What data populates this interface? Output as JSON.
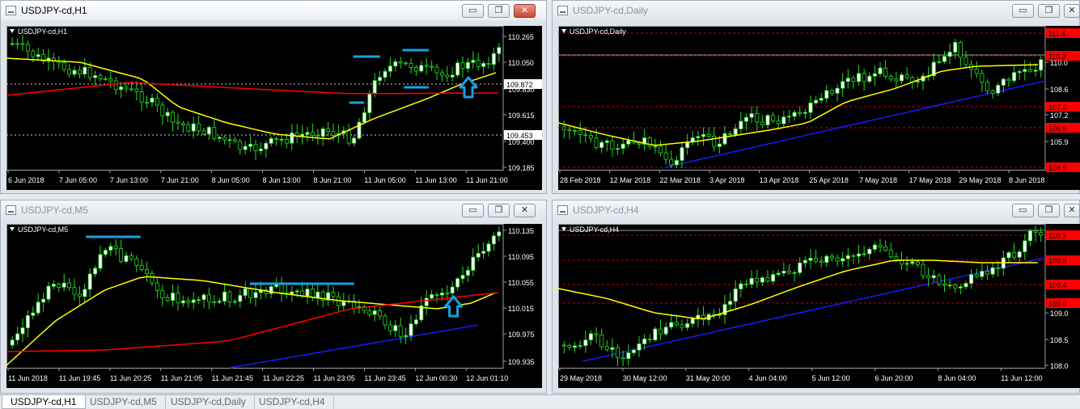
{
  "windows": [
    {
      "key": "h1",
      "title": "USDJPY-cd,H1",
      "symbol_label": "USDJPY-cd,H1",
      "state": "active",
      "price_labels": [
        "110.265",
        "110.050",
        "109.830",
        "109.615",
        "109.400",
        "109.185"
      ],
      "marker_labels": [
        {
          "text": "109.872",
          "bg": "#ffffff",
          "color": "#000000"
        },
        {
          "text": "109.453",
          "bg": "#ffffff",
          "color": "#000000"
        }
      ],
      "time_labels": [
        "6 Jun 2018",
        "7 Jun 05:00",
        "7 Jun 13:00",
        "7 Jun 21:00",
        "8 Jun 05:00",
        "8 Jun 13:00",
        "8 Jun 21:00",
        "11 Jun 05:00",
        "11 Jun 13:00",
        "11 Jun 21:00"
      ]
    },
    {
      "key": "daily",
      "title": "USDJPY-cd,Daily",
      "symbol_label": "USDJPY-cd,Daily",
      "state": "inactive",
      "price_labels": [
        "110.0",
        "108.6",
        "107.2",
        "105.9"
      ],
      "marker_labels": [
        {
          "text": "111.4",
          "bg": "#ff0000",
          "color": "#000000"
        },
        {
          "text": "110.3",
          "bg": "#ff0000",
          "color": "#000000"
        },
        {
          "text": "107.6",
          "bg": "#ff0000",
          "color": "#000000"
        },
        {
          "text": "106.6",
          "bg": "#ff0000",
          "color": "#000000"
        },
        {
          "text": "104.5",
          "bg": "#ff0000",
          "color": "#000000"
        }
      ],
      "time_labels": [
        "28 Feb 2018",
        "12 Mar 2018",
        "22 Mar 2018",
        "3 Apr 2018",
        "13 Apr 2018",
        "25 Apr 2018",
        "7 May 2018",
        "17 May 2018",
        "29 May 2018",
        "8 Jun 2018"
      ]
    },
    {
      "key": "m5",
      "title": "USDJPY-cd,M5",
      "symbol_label": "USDJPY-cd,M5",
      "state": "inactive",
      "price_labels": [
        "110.135",
        "110.095",
        "110.055",
        "110.015",
        "109.975",
        "109.935"
      ],
      "marker_labels": [],
      "time_labels": [
        "11 Jun 2018",
        "11 Jun 19:45",
        "11 Jun 20:25",
        "11 Jun 21:05",
        "11 Jun 21:45",
        "11 Jun 22:25",
        "11 Jun 23:05",
        "11 Jun 23:45",
        "12 Jun 00:30",
        "12 Jun 01:10"
      ]
    },
    {
      "key": "h4",
      "title": "USDJPY-cd,H4",
      "symbol_label": "USDJPY-cd,H4",
      "state": "inactive",
      "price_labels": [
        "109.0",
        "108.5",
        "108.0"
      ],
      "marker_labels": [
        {
          "text": "110.3",
          "bg": "#ff0000",
          "color": "#000000"
        },
        {
          "text": "109.8",
          "bg": "#ff0000",
          "color": "#000000"
        },
        {
          "text": "109.4",
          "bg": "#ff0000",
          "color": "#000000"
        },
        {
          "text": "109.0",
          "bg": "#ff0000",
          "color": "#000000"
        }
      ],
      "time_labels": [
        "29 May 2018",
        "30 May 12:00",
        "31 May 20:00",
        "4 Jun 04:00",
        "5 Jun 12:00",
        "6 Jun 20:00",
        "8 Jun 04:00",
        "11 Jun 12:00"
      ]
    }
  ],
  "window_buttons": {
    "minimize": "▭",
    "maximize": "❐",
    "close": "✕"
  },
  "tabs": [
    {
      "label": "USDJPY-cd,H1",
      "active": true
    },
    {
      "label": "USDJPY-cd,M5",
      "active": false
    },
    {
      "label": "USDJPY-cd,Daily",
      "active": false
    },
    {
      "label": "USDJPY-cd,H4",
      "active": false
    }
  ],
  "colors": {
    "candle": "#22dd22",
    "ma_fast": "#ffff00",
    "ma_slow": "#ff0000",
    "trendline": "#1a1aff",
    "level_line": "#cc0000",
    "annotation": "#1a9fe0",
    "background": "#000000"
  },
  "icons": {
    "window": "chart-window-icon",
    "symbol_menu": "triangle-down-icon",
    "annotation_arrow": "up-arrow-icon"
  }
}
